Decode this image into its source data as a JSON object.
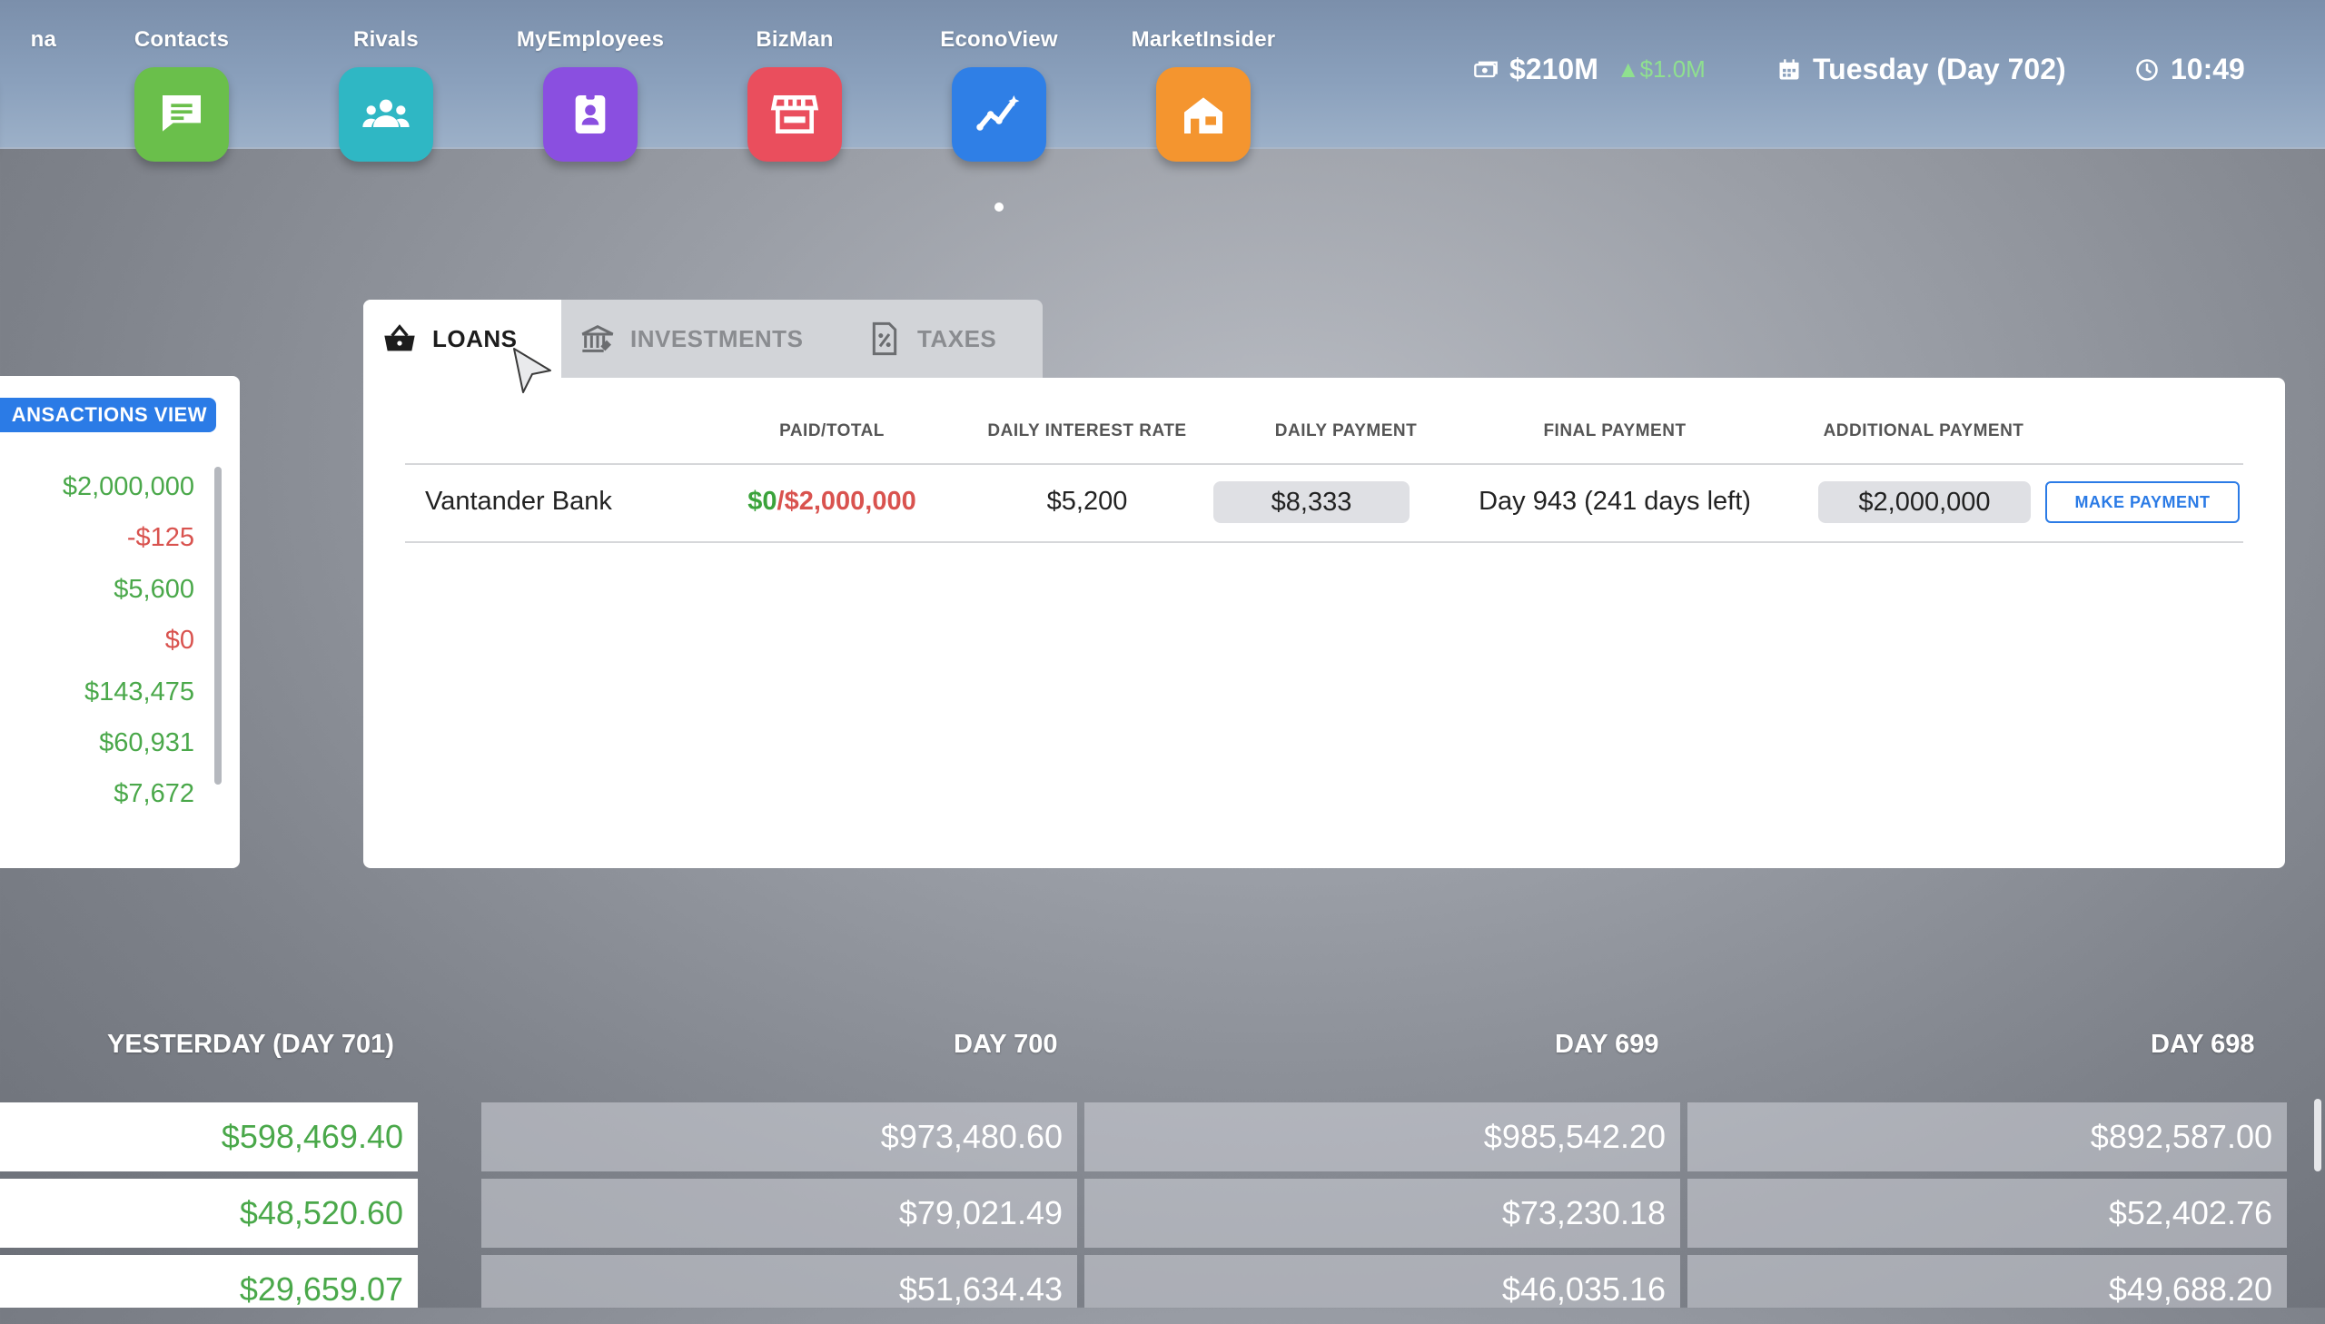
{
  "topbar": {
    "partial_app_label": "na",
    "apps": [
      {
        "label": "Contacts",
        "color": "#6abf4b"
      },
      {
        "label": "Rivals",
        "color": "#2fb7c4"
      },
      {
        "label": "MyEmployees",
        "color": "#8a4fe0"
      },
      {
        "label": "BizMan",
        "color": "#ea4e5d"
      },
      {
        "label": "EconoView",
        "color": "#2f7fe6"
      },
      {
        "label": "MarketInsider",
        "color": "#f4952f"
      }
    ],
    "money": "$210M",
    "money_delta": "$1.0M",
    "day": "Tuesday (Day 702)",
    "time": "10:49"
  },
  "side_panel": {
    "title": "ANSACTIONS VIEW",
    "values": [
      {
        "text": "$2,000,000",
        "sign": "pos"
      },
      {
        "text": "-$125",
        "sign": "neg"
      },
      {
        "text": "$5,600",
        "sign": "pos"
      },
      {
        "text": "$0",
        "sign": "neg"
      },
      {
        "text": "$143,475",
        "sign": "pos"
      },
      {
        "text": "$60,931",
        "sign": "pos"
      },
      {
        "text": "$7,672",
        "sign": "pos"
      }
    ]
  },
  "tabs": {
    "loans": "LOANS",
    "investments": "INVESTMENTS",
    "taxes": "TAXES"
  },
  "loans_table": {
    "headers": {
      "paid_total": "PAID/TOTAL",
      "daily_rate": "DAILY INTEREST RATE",
      "daily_payment": "DAILY PAYMENT",
      "final_payment": "FINAL PAYMENT",
      "additional_payment": "ADDITIONAL PAYMENT"
    },
    "row": {
      "lender": "Vantander Bank",
      "paid": "$0",
      "slash": "/",
      "total": "$2,000,000",
      "daily_rate": "$5,200",
      "daily_payment": "$8,333",
      "final_payment": "Day 943 (241 days left)",
      "additional_payment": "$2,000,000"
    },
    "make_payment_label": "MAKE PAYMENT"
  },
  "history": {
    "columns": [
      "YESTERDAY (DAY 701)",
      "DAY 700",
      "DAY 699",
      "DAY 698"
    ],
    "rows": [
      [
        "$598,469.40",
        "$973,480.60",
        "$985,542.20",
        "$892,587.00"
      ],
      [
        "$48,520.60",
        "$79,021.49",
        "$73,230.18",
        "$52,402.76"
      ],
      [
        "$29,659.07",
        "$51,634.43",
        "$46,035.16",
        "$49,688.20"
      ]
    ]
  }
}
